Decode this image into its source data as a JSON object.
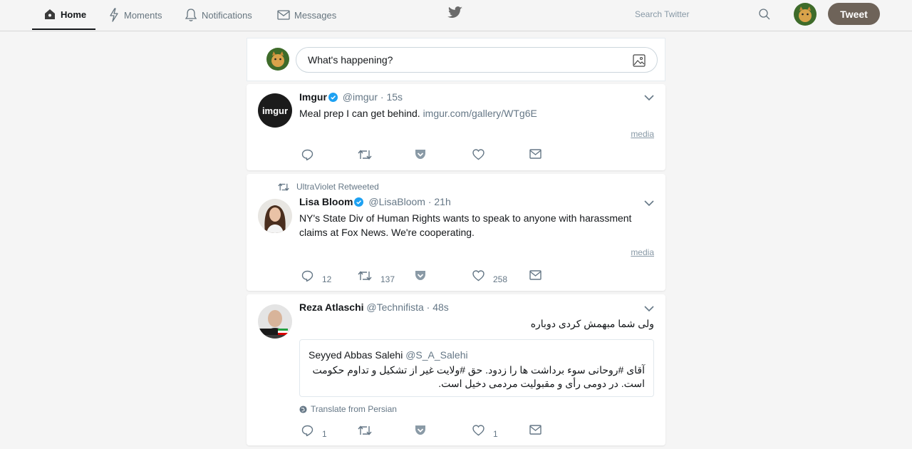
{
  "nav": {
    "home": "Home",
    "moments": "Moments",
    "notifications": "Notifications",
    "messages": "Messages",
    "search_placeholder": "Search Twitter",
    "tweet_button": "Tweet"
  },
  "compose": {
    "placeholder": "What's happening?"
  },
  "tweets": [
    {
      "name": "Imgur",
      "handle": "@imgur",
      "sep": "·",
      "time": "15s",
      "verified": true,
      "text": "Meal prep I can get behind.",
      "link": "imgur.com/gallery/WTg6E",
      "media_label": "media",
      "counts": {
        "reply": "",
        "retweet": "",
        "like": ""
      }
    },
    {
      "retweeted_by": "UltraViolet Retweeted",
      "name": "Lisa Bloom",
      "handle": "@LisaBloom",
      "sep": "·",
      "time": "21h",
      "verified": true,
      "text": "NY's State Div of Human Rights wants to speak to anyone with harassment claims at Fox News. We're cooperating.",
      "media_label": "media",
      "counts": {
        "reply": "12",
        "retweet": "137",
        "like": "258"
      }
    },
    {
      "name": "Reza Atlaschi",
      "handle": "@Technifista",
      "sep": "·",
      "time": "48s",
      "text": "ولی شما مبهمش کردی دوباره",
      "quote": {
        "name": "Seyyed Abbas Salehi",
        "handle": "@S_A_Salehi",
        "text": "آقای #روحانی سوء برداشت ها را زدود. حق #ولایت غیر از تشکیل و تداوم حکومت است. در دومی رأی و مقبولیت مردمی دخیل است."
      },
      "translate": "Translate from Persian",
      "counts": {
        "reply": "1",
        "retweet": "",
        "like": "1"
      }
    }
  ],
  "colors": {
    "accent": "#1da1f2",
    "tweet_button": "#6e6359",
    "muted": "#657786"
  },
  "icons": [
    "home-icon",
    "lightning-icon",
    "bell-icon",
    "envelope-icon",
    "bird-icon",
    "search-icon",
    "photo-icon",
    "chevron-down-icon",
    "reply-icon",
    "retweet-icon",
    "pocket-icon",
    "heart-icon",
    "dm-icon",
    "globe-icon",
    "verified-icon"
  ]
}
